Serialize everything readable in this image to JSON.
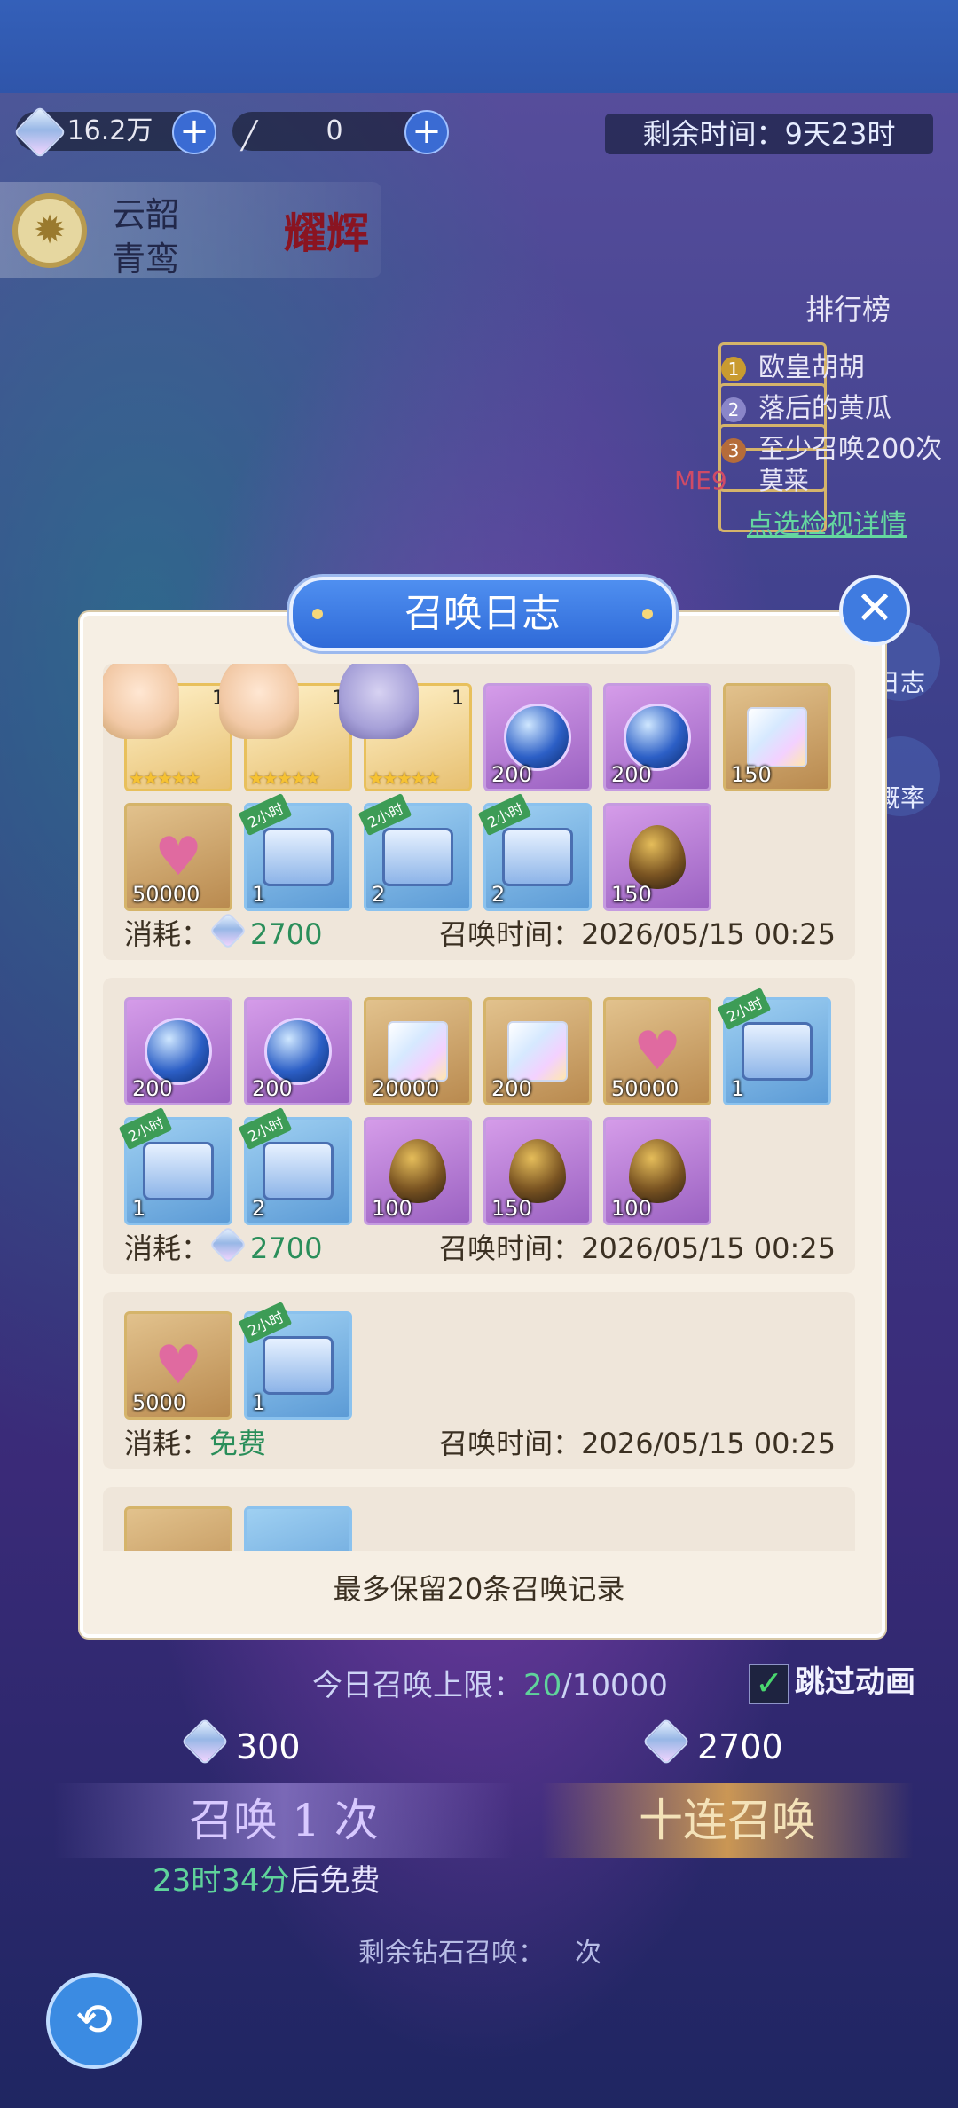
{
  "resources": {
    "diamonds": "16.2万",
    "keys": "0"
  },
  "event": {
    "timer_label": "剩余时间：",
    "timer_value": "9天23时"
  },
  "character": {
    "name_line1": "云韶",
    "name_line2": "青鸾",
    "honor": "耀辉"
  },
  "ranking": {
    "title": "排行榜",
    "entries": [
      "欧皇胡胡",
      "落后的黄瓜",
      "至少召唤200次"
    ],
    "me_label": "ME",
    "me_rank": "9",
    "me_name": "莫莱",
    "detail_link": "点选检视详情"
  },
  "side_buttons": [
    "日志",
    "概率"
  ],
  "dialog": {
    "title": "召唤日志",
    "close_icon": "close-icon",
    "cost_label": "消耗：",
    "time_label": "召唤时间：",
    "bottom_note": "最多保留20条召唤记录",
    "records": [
      {
        "cost": "2700",
        "time": "2026/05/15 00:25",
        "items": [
          {
            "type": "hero",
            "count": "",
            "level": "1"
          },
          {
            "type": "hero",
            "count": "",
            "level": "1"
          },
          {
            "type": "hero2",
            "count": "",
            "level": "1"
          },
          {
            "type": "orb",
            "count": "200"
          },
          {
            "type": "orb",
            "count": "200"
          },
          {
            "type": "crystal",
            "count": "150"
          },
          {
            "type": "exp",
            "count": "50000"
          },
          {
            "type": "chest",
            "count": "1",
            "tag": "2小时"
          },
          {
            "type": "chest-gold",
            "count": "2",
            "tag": "2小时"
          },
          {
            "type": "chest-gold",
            "count": "2",
            "tag": "2小时"
          },
          {
            "type": "egg",
            "count": "150"
          }
        ]
      },
      {
        "cost": "2700",
        "time": "2026/05/15 00:25",
        "items": [
          {
            "type": "orb",
            "count": "200"
          },
          {
            "type": "orb",
            "count": "200"
          },
          {
            "type": "crystal",
            "count": "20000"
          },
          {
            "type": "crystal",
            "count": "200"
          },
          {
            "type": "exp",
            "count": "50000"
          },
          {
            "type": "chest",
            "count": "1",
            "tag": "2小时"
          },
          {
            "type": "chest",
            "count": "1",
            "tag": "2小时"
          },
          {
            "type": "chest-gold",
            "count": "2",
            "tag": "2小时"
          },
          {
            "type": "egg",
            "count": "100"
          },
          {
            "type": "egg",
            "count": "150"
          },
          {
            "type": "egg",
            "count": "100"
          }
        ]
      },
      {
        "cost": "免费",
        "time": "2026/05/15 00:25",
        "items": [
          {
            "type": "exp",
            "count": "5000"
          },
          {
            "type": "chest",
            "count": "1",
            "tag": "2小时"
          }
        ]
      }
    ]
  },
  "summon": {
    "daily_label": "今日召唤上限：",
    "daily_used": "20",
    "daily_max": "/10000",
    "skip_label": "跳过动画",
    "single_price": "300",
    "ten_price": "2700",
    "single_label": "召唤 1 次",
    "ten_label": "十连召唤",
    "free_time": "23时34分",
    "free_suffix": "后免费",
    "remain_label": "剩余钻石召唤：",
    "remain_suffix": "次"
  }
}
